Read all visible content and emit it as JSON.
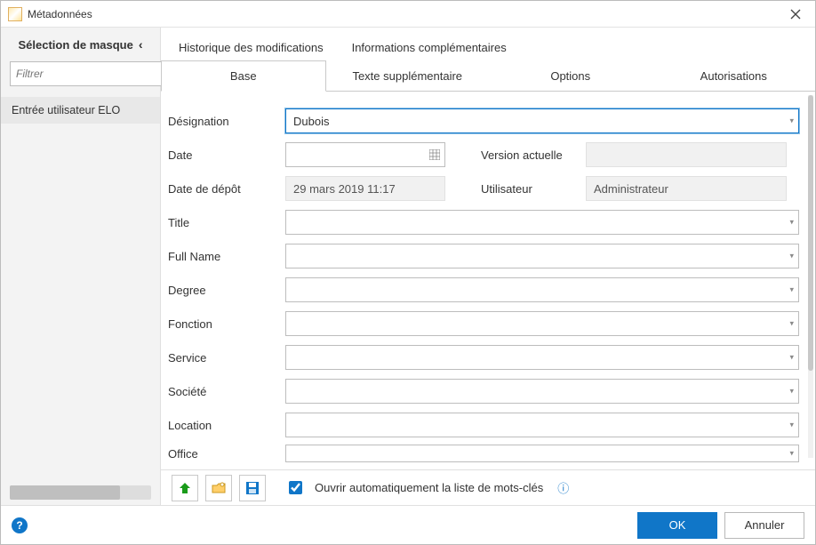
{
  "window": {
    "title": "Métadonnées"
  },
  "sidebar": {
    "header": "Sélection de masque",
    "filter_placeholder": "Filtrer",
    "items": [
      {
        "label": "Entrée utilisateur ELO"
      }
    ]
  },
  "top_links": {
    "history": "Historique des modifications",
    "info": "Informations complémentaires"
  },
  "tabs": {
    "base": "Base",
    "extra_text": "Texte supplémentaire",
    "options": "Options",
    "auth": "Autorisations"
  },
  "form": {
    "designation": {
      "label": "Désignation",
      "value": "Dubois"
    },
    "date": {
      "label": "Date",
      "value": ""
    },
    "current_version": {
      "label": "Version actuelle",
      "value": ""
    },
    "filing_date": {
      "label": "Date de dépôt",
      "value": "29 mars 2019 11:17"
    },
    "user": {
      "label": "Utilisateur",
      "value": "Administrateur"
    },
    "title": {
      "label": "Title",
      "value": ""
    },
    "full_name": {
      "label": "Full Name",
      "value": ""
    },
    "degree": {
      "label": "Degree",
      "value": ""
    },
    "function": {
      "label": "Fonction",
      "value": ""
    },
    "service": {
      "label": "Service",
      "value": ""
    },
    "company": {
      "label": "Société",
      "value": ""
    },
    "location": {
      "label": "Location",
      "value": ""
    },
    "office": {
      "label": "Office",
      "value": ""
    }
  },
  "toolbar": {
    "checkbox_label": "Ouvrir automatiquement la liste de mots-clés",
    "checked": true
  },
  "footer": {
    "ok": "OK",
    "cancel": "Annuler"
  }
}
